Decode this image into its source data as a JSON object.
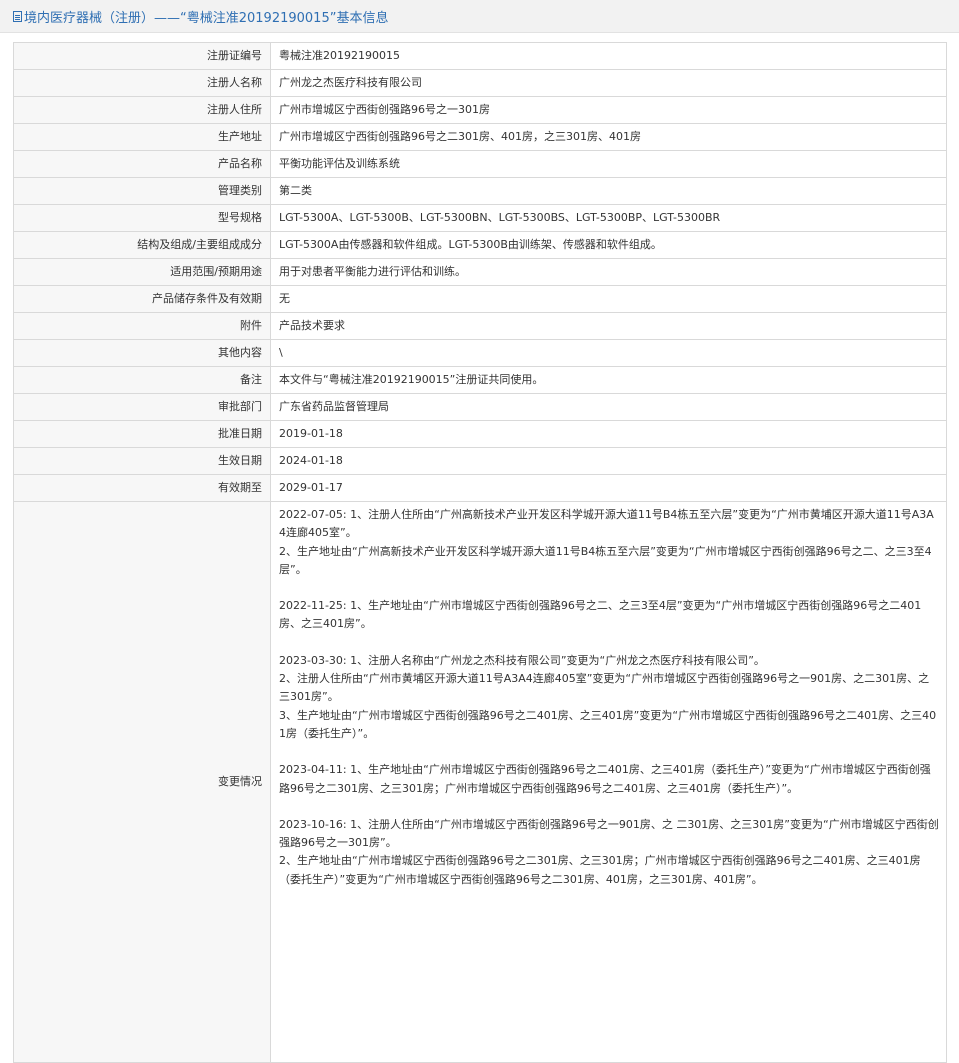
{
  "header": {
    "title": "境内医疗器械（注册）——“粤械注准20192190015”基本信息"
  },
  "fields": [
    {
      "label": "注册证编号",
      "value": "粤械注准20192190015"
    },
    {
      "label": "注册人名称",
      "value": "广州龙之杰医疗科技有限公司"
    },
    {
      "label": "注册人住所",
      "value": "广州市增城区宁西街创强路96号之一301房"
    },
    {
      "label": "生产地址",
      "value": "广州市增城区宁西街创强路96号之二301房、401房，之三301房、401房"
    },
    {
      "label": "产品名称",
      "value": "平衡功能评估及训练系统"
    },
    {
      "label": "管理类别",
      "value": "第二类"
    },
    {
      "label": "型号规格",
      "value": "LGT-5300A、LGT-5300B、LGT-5300BN、LGT-5300BS、LGT-5300BP、LGT-5300BR"
    },
    {
      "label": "结构及组成/主要组成成分",
      "value": "LGT-5300A由传感器和软件组成。LGT-5300B由训练架、传感器和软件组成。"
    },
    {
      "label": "适用范围/预期用途",
      "value": "用于对患者平衡能力进行评估和训练。"
    },
    {
      "label": "产品储存条件及有效期",
      "value": "无"
    },
    {
      "label": "附件",
      "value": "产品技术要求"
    },
    {
      "label": "其他内容",
      "value": "\\"
    },
    {
      "label": "备注",
      "value": "本文件与“粤械注准20192190015”注册证共同使用。"
    },
    {
      "label": "审批部门",
      "value": "广东省药品监督管理局"
    },
    {
      "label": "批准日期",
      "value": "2019-01-18"
    },
    {
      "label": "生效日期",
      "value": "2024-01-18"
    },
    {
      "label": "有效期至",
      "value": "2029-01-17"
    }
  ],
  "changes": {
    "label": "变更情况",
    "entries": [
      {
        "lines": [
          "2022-07-05: 1、注册人住所由“广州高新技术产业开发区科学城开源大道11号B4栋五至六层”变更为“广州市黄埔区开源大道11号A3A4连廊405室”。",
          "2、生产地址由“广州高新技术产业开发区科学城开源大道11号B4栋五至六层”变更为“广州市增城区宁西街创强路96号之二、之三3至4层”。"
        ]
      },
      {
        "lines": [
          "2022-11-25: 1、生产地址由“广州市增城区宁西街创强路96号之二、之三3至4层”变更为“广州市增城区宁西街创强路96号之二401房、之三401房”。"
        ]
      },
      {
        "lines": [
          "2023-03-30: 1、注册人名称由“广州龙之杰科技有限公司”变更为“广州龙之杰医疗科技有限公司”。",
          "2、注册人住所由“广州市黄埔区开源大道11号A3A4连廊405室”变更为“广州市增城区宁西街创强路96号之一901房、之二301房、之三301房”。",
          "3、生产地址由“广州市增城区宁西街创强路96号之二401房、之三401房”变更为“广州市增城区宁西街创强路96号之二401房、之三401房（委托生产）”。"
        ]
      },
      {
        "lines": [
          "2023-04-11: 1、生产地址由“广州市增城区宁西街创强路96号之二401房、之三401房（委托生产）”变更为“广州市增城区宁西街创强路96号之二301房、之三301房；广州市增城区宁西街创强路96号之二401房、之三401房（委托生产）”。"
        ]
      },
      {
        "lines": [
          "2023-10-16: 1、注册人住所由“广州市增城区宁西街创强路96号之一901房、之 二301房、之三301房”变更为“广州市增城区宁西街创强路96号之一301房”。",
          "2、生产地址由“广州市增城区宁西街创强路96号之二301房、之三301房；广州市增城区宁西街创强路96号之二401房、之三401房（委托生产）”变更为“广州市增城区宁西街创强路96号之二301房、401房，之三301房、401房”。"
        ]
      }
    ]
  }
}
